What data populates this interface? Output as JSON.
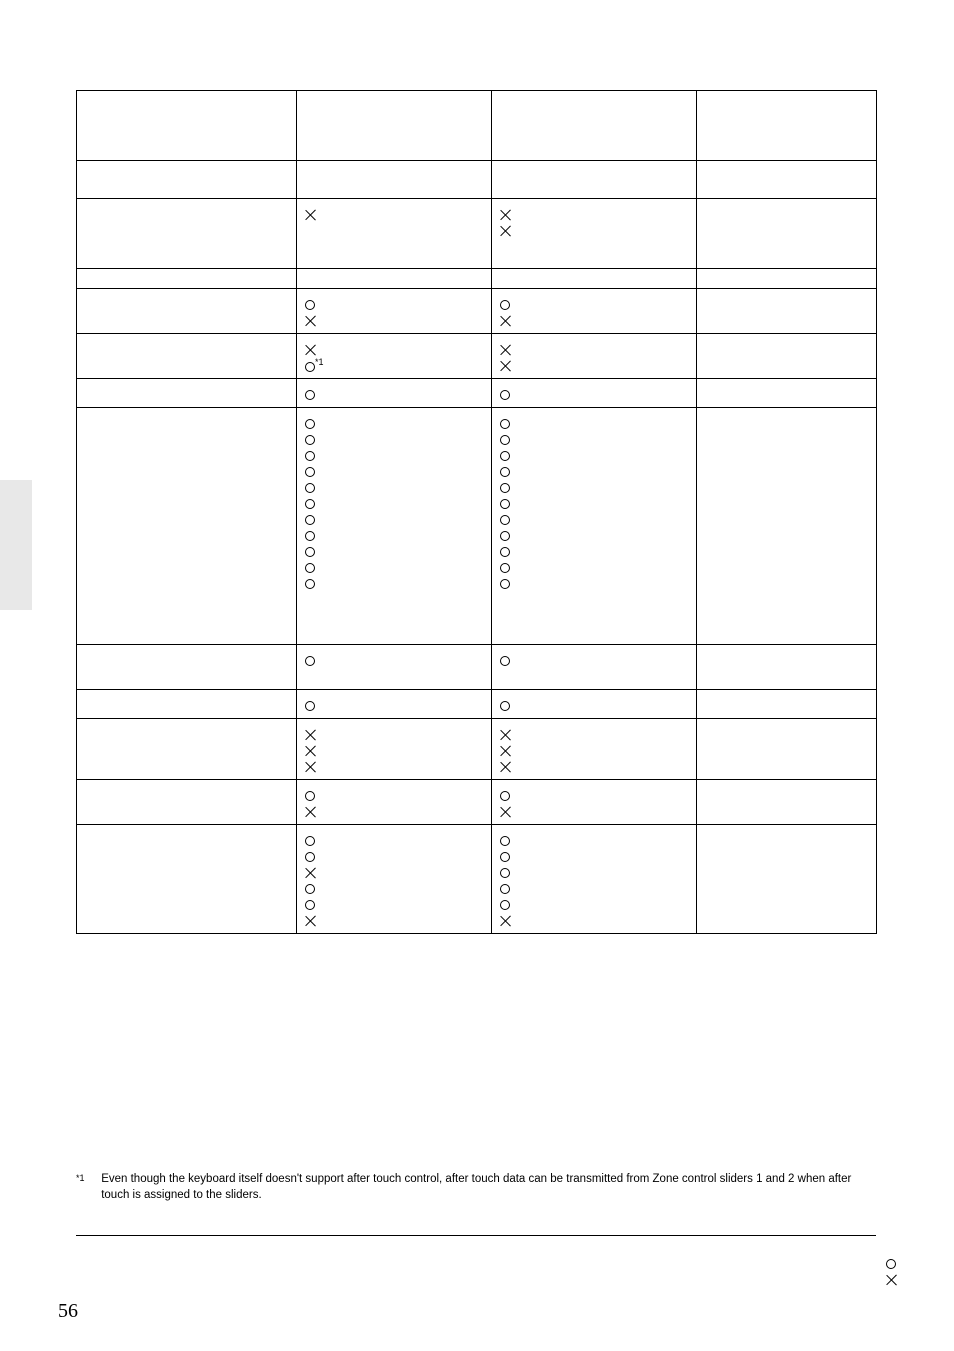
{
  "page_number": "56",
  "footnote": {
    "marker": "*1",
    "text": "Even though the keyboard itself doesn't support after touch control, after touch data can be transmitted from Zone control sliders 1 and 2 when after touch is assigned to the sliders."
  },
  "table": {
    "rows": [
      {
        "c1": "",
        "c2": [],
        "c3": [],
        "c4": "",
        "height": "h1"
      },
      {
        "c1": "",
        "c2": [],
        "c3": [],
        "c4": "",
        "height": "h2"
      },
      {
        "c1": "",
        "c2": [
          "x"
        ],
        "c3": [
          "x",
          "x"
        ],
        "c4": "",
        "height": "h1"
      },
      {
        "c1": "",
        "c2": [],
        "c3": [],
        "c4": "",
        "height": "h3"
      },
      {
        "c1": "",
        "c2": [
          "o",
          "x"
        ],
        "c3": [
          "o",
          "x"
        ],
        "c4": ""
      },
      {
        "c1": "",
        "c2": [
          "x",
          "o*1"
        ],
        "c3": [
          "x",
          "x"
        ],
        "c4": ""
      },
      {
        "c1": "",
        "c2": [
          "o"
        ],
        "c3": [
          "o"
        ],
        "c4": ""
      },
      {
        "c1": "",
        "c2": [
          "o",
          "o",
          "o",
          "o",
          "o",
          "o",
          "o",
          "o",
          "o",
          "o",
          "o",
          "",
          "",
          ""
        ],
        "c3": [
          "o",
          "o",
          "o",
          "o",
          "o",
          "o",
          "o",
          "o",
          "o",
          "o",
          "o",
          "",
          "",
          ""
        ],
        "c4": ""
      },
      {
        "c1": "",
        "c2": [
          "o",
          ""
        ],
        "c3": [
          "o",
          ""
        ],
        "c4": ""
      },
      {
        "c1": "",
        "c2": [
          "o"
        ],
        "c3": [
          "o"
        ],
        "c4": ""
      },
      {
        "c1": "",
        "c2": [
          "x",
          "x",
          "x"
        ],
        "c3": [
          "x",
          "x",
          "x"
        ],
        "c4": ""
      },
      {
        "c1": "",
        "c2": [
          "o",
          "x"
        ],
        "c3": [
          "o",
          "x"
        ],
        "c4": ""
      },
      {
        "c1": "",
        "c2": [
          "o",
          "o",
          "x",
          "o",
          "o",
          "x"
        ],
        "c3": [
          "o",
          "o",
          "o",
          "o",
          "o",
          "x"
        ],
        "c4": ""
      }
    ]
  },
  "legend": [
    "o",
    "x"
  ]
}
